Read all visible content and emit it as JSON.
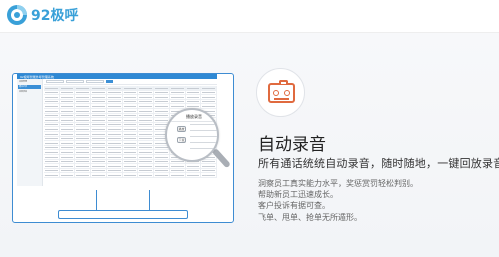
{
  "brand": {
    "name": "92极呼",
    "color": "#39a0d8"
  },
  "accent": "#e06a3f",
  "monitor_color": "#3e8cd2",
  "app": {
    "title": "92极呼智能外呼管理系统",
    "sidebar": [
      "话单管理",
      "通话记录",
      "话单录音"
    ],
    "magnifier": {
      "title": "播放录音",
      "buttons": [
        "播放",
        "下载"
      ]
    }
  },
  "feature": {
    "title": "自动录音",
    "subtitle": "所有通话统统自动录音，随时随地，一键回放录音。",
    "bullets": [
      "洞察员工真实能力水平，奖惩赏罚轻松判别。",
      "帮助新员工迅速成长。",
      "客户投诉有据可查。",
      "飞单、甩单、抢单无所遁形。"
    ]
  }
}
